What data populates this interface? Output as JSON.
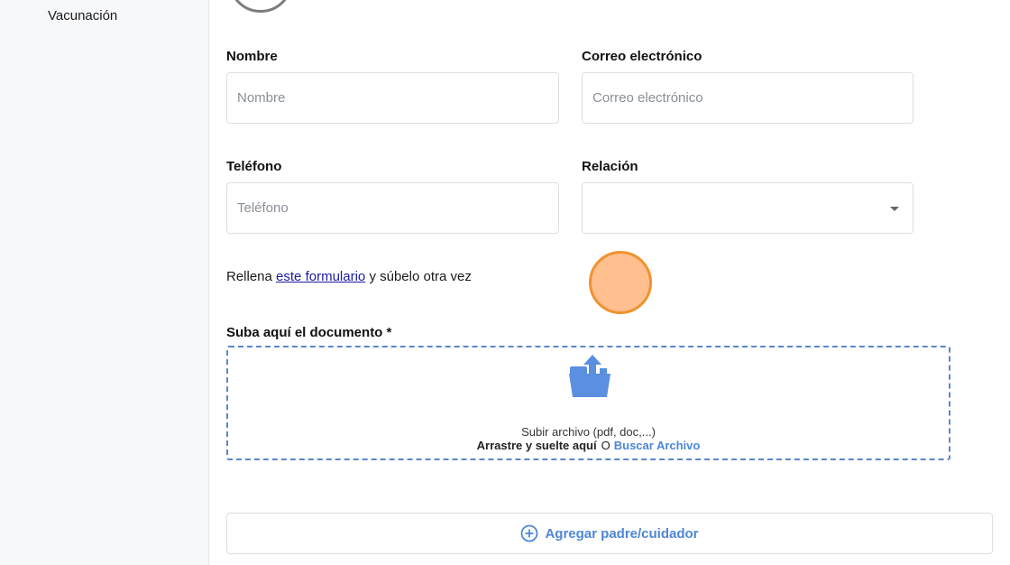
{
  "sidebar": {
    "items": [
      {
        "label": "Vacunación"
      }
    ]
  },
  "form": {
    "name": {
      "label": "Nombre",
      "placeholder": "Nombre",
      "value": ""
    },
    "email": {
      "label": "Correo electrónico",
      "placeholder": "Correo electrónico",
      "value": ""
    },
    "phone": {
      "label": "Teléfono",
      "placeholder": "Teléfono",
      "value": ""
    },
    "relation": {
      "label": "Relación",
      "value": ""
    }
  },
  "helper": {
    "prefix": "Rellena",
    "link": "este formulario",
    "suffix": "y súbelo otra vez"
  },
  "upload": {
    "label": "Suba aquí el documento *",
    "hint": "Subir archivo (pdf, doc,...)",
    "drag_text": "Arrastre y suelte aquí",
    "or_text": "O",
    "browse_text": "Buscar Archivo",
    "icon": "folder-upload-icon"
  },
  "actions": {
    "add_guardian": "Agregar padre/cuidador",
    "icon": "plus-circle-icon"
  },
  "colors": {
    "accent": "#4d86d6",
    "upload_border": "#5b86c9",
    "link": "#1a1aa6",
    "cursor_fill": "#ffbf8f",
    "cursor_border": "#f0922f"
  }
}
